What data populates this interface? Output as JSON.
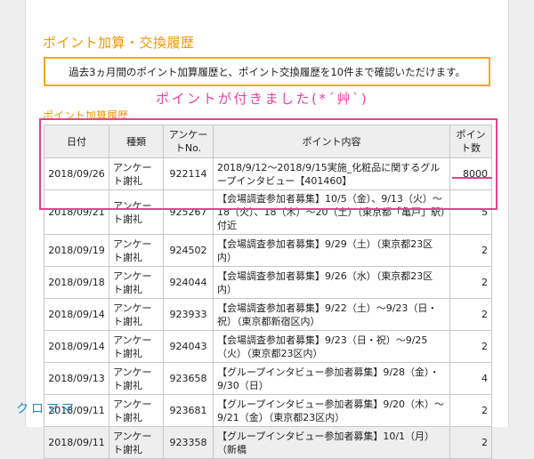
{
  "page": {
    "title": "ポイント加算・交換履歴",
    "notice": "過去3ヵ月間のポイント加算履歴と、ポイント交換履歴を10件まで確認いただけます。",
    "section_title": "ポイント加算履歴"
  },
  "annotation": {
    "text": "ポイントが付きました(*´艸`)",
    "signature": "クロママ",
    "color": "#e8428f"
  },
  "table": {
    "headers": {
      "date": "日付",
      "type": "種類",
      "survey_no": "アンケートNo.",
      "content": "ポイント内容",
      "points": "ポイント数"
    },
    "rows": [
      {
        "date": "2018/09/26",
        "type": "アンケート謝礼",
        "no": "922114",
        "content": "2018/9/12～2018/9/15実施_化粧品に関するグループインタビュー【401460】",
        "points": "8000"
      },
      {
        "date": "2018/09/21",
        "type": "アンケート謝礼",
        "no": "925267",
        "content": "【会場調査参加者募集】10/5（金）、9/13（火）～18（火）、18（木）～20（土）（東京都「亀戸」駅）付近",
        "points": "5"
      },
      {
        "date": "2018/09/19",
        "type": "アンケート謝礼",
        "no": "924502",
        "content": "【会場調査参加者募集】9/29（土）（東京都23区内）",
        "points": "2"
      },
      {
        "date": "2018/09/18",
        "type": "アンケート謝礼",
        "no": "924044",
        "content": "【会場調査参加者募集】9/26（水）（東京都23区内）",
        "points": "2"
      },
      {
        "date": "2018/09/14",
        "type": "アンケート謝礼",
        "no": "923933",
        "content": "【会場調査参加者募集】9/22（土）～9/23（日・祝）（東京都新宿区内）",
        "points": "2"
      },
      {
        "date": "2018/09/14",
        "type": "アンケート謝礼",
        "no": "924043",
        "content": "【会場調査参加者募集】9/23（日・祝）～9/25（火）（東京都23区内）",
        "points": "2"
      },
      {
        "date": "2018/09/13",
        "type": "アンケート謝礼",
        "no": "923658",
        "content": "【グループインタビュー参加者募集】9/28（金）・9/30（日）",
        "points": "4"
      },
      {
        "date": "2018/09/11",
        "type": "アンケート謝礼",
        "no": "923681",
        "content": "【グループインタビュー参加者募集】9/20（木）～9/21（金）（東京都23区内）",
        "points": "2"
      },
      {
        "date": "2018/09/11",
        "type": "アンケート謝礼",
        "no": "923358",
        "content": "【グループインタビュー参加者募集】10/1（月）（新橋",
        "points": "2"
      }
    ]
  }
}
